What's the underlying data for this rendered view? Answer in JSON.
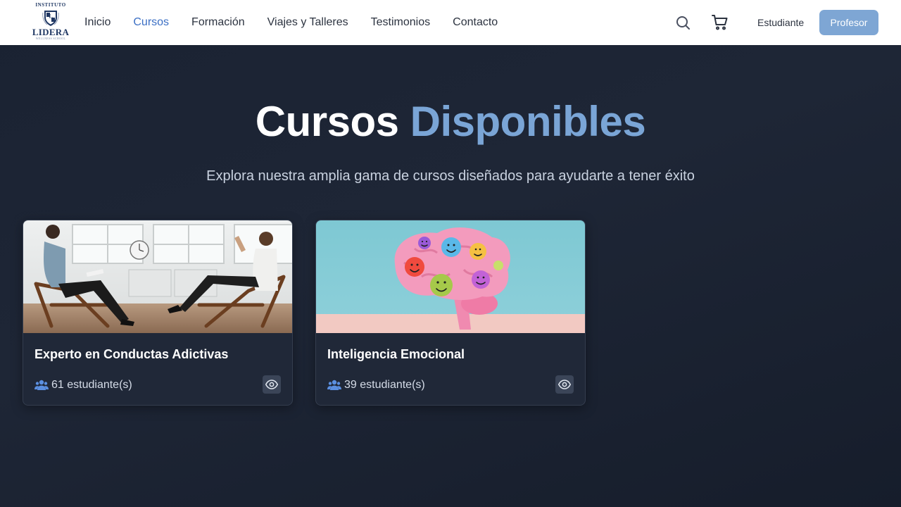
{
  "nav": {
    "logo": {
      "arc_text": "INSTITUTO",
      "name": "LIDERA",
      "subtitle": "WELLNESS SCHOOL",
      "brand_color": "#1f3763"
    },
    "links": [
      {
        "label": "Inicio",
        "active": false
      },
      {
        "label": "Cursos",
        "active": true
      },
      {
        "label": "Formación",
        "active": false
      },
      {
        "label": "Viajes y Talleres",
        "active": false
      },
      {
        "label": "Testimonios",
        "active": false
      },
      {
        "label": "Contacto",
        "active": false
      }
    ],
    "icons": [
      "search-icon",
      "cart-icon"
    ],
    "student_label": "Estudiante",
    "teacher_label": "Profesor",
    "accent_color": "#7ea6d4",
    "active_color": "#3b6fc4"
  },
  "hero": {
    "title_part1": "Cursos",
    "title_part2": "Disponibles",
    "subtitle": "Explora nuestra amplia gama de cursos diseñados para ayudarte a tener éxito",
    "title_accent_color": "#7aa5d6"
  },
  "courses": [
    {
      "title": "Experto en Conductas Adictivas",
      "students": "61 estudiante(s)",
      "image": "therapy-session-photo",
      "icons": [
        "users-icon",
        "eye-icon"
      ]
    },
    {
      "title": "Inteligencia Emocional",
      "students": "39 estudiante(s)",
      "image": "brain-emojis-illustration",
      "icons": [
        "users-icon",
        "eye-icon"
      ]
    }
  ]
}
